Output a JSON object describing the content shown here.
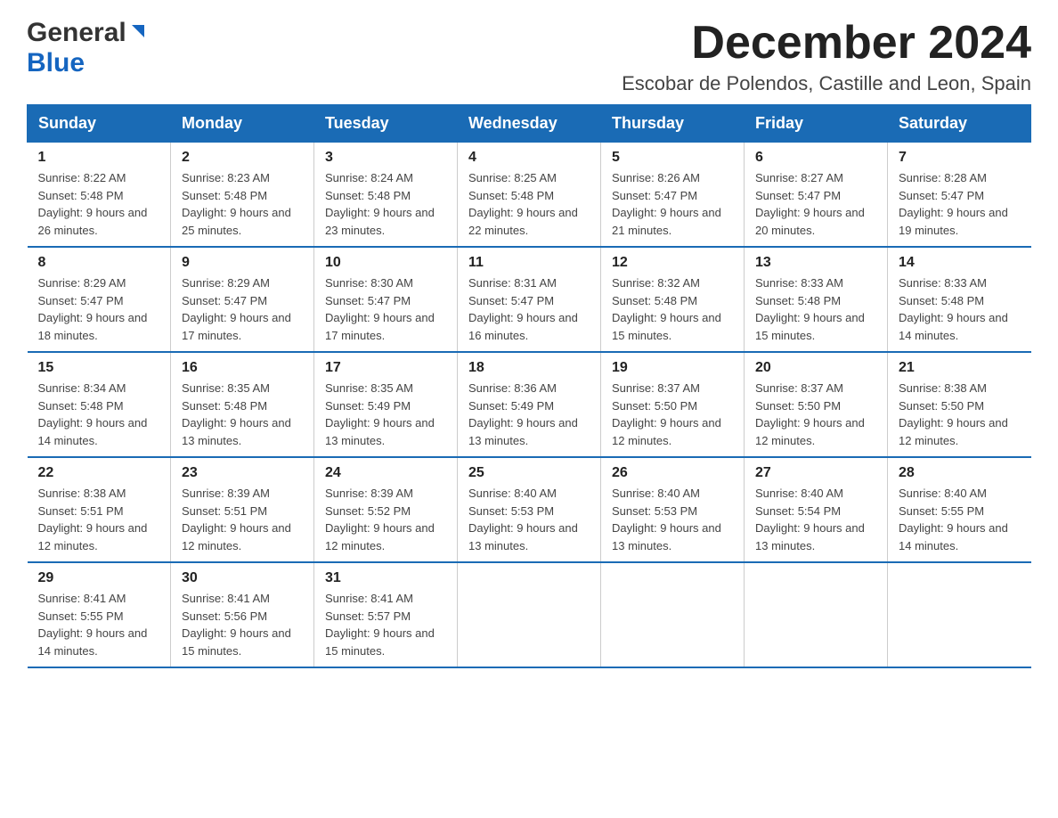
{
  "header": {
    "logo_general": "General",
    "logo_blue": "Blue",
    "month_title": "December 2024",
    "location": "Escobar de Polendos, Castille and Leon, Spain"
  },
  "days_of_week": [
    "Sunday",
    "Monday",
    "Tuesday",
    "Wednesday",
    "Thursday",
    "Friday",
    "Saturday"
  ],
  "weeks": [
    [
      {
        "day": "1",
        "sunrise": "8:22 AM",
        "sunset": "5:48 PM",
        "daylight": "9 hours and 26 minutes."
      },
      {
        "day": "2",
        "sunrise": "8:23 AM",
        "sunset": "5:48 PM",
        "daylight": "9 hours and 25 minutes."
      },
      {
        "day": "3",
        "sunrise": "8:24 AM",
        "sunset": "5:48 PM",
        "daylight": "9 hours and 23 minutes."
      },
      {
        "day": "4",
        "sunrise": "8:25 AM",
        "sunset": "5:48 PM",
        "daylight": "9 hours and 22 minutes."
      },
      {
        "day": "5",
        "sunrise": "8:26 AM",
        "sunset": "5:47 PM",
        "daylight": "9 hours and 21 minutes."
      },
      {
        "day": "6",
        "sunrise": "8:27 AM",
        "sunset": "5:47 PM",
        "daylight": "9 hours and 20 minutes."
      },
      {
        "day": "7",
        "sunrise": "8:28 AM",
        "sunset": "5:47 PM",
        "daylight": "9 hours and 19 minutes."
      }
    ],
    [
      {
        "day": "8",
        "sunrise": "8:29 AM",
        "sunset": "5:47 PM",
        "daylight": "9 hours and 18 minutes."
      },
      {
        "day": "9",
        "sunrise": "8:29 AM",
        "sunset": "5:47 PM",
        "daylight": "9 hours and 17 minutes."
      },
      {
        "day": "10",
        "sunrise": "8:30 AM",
        "sunset": "5:47 PM",
        "daylight": "9 hours and 17 minutes."
      },
      {
        "day": "11",
        "sunrise": "8:31 AM",
        "sunset": "5:47 PM",
        "daylight": "9 hours and 16 minutes."
      },
      {
        "day": "12",
        "sunrise": "8:32 AM",
        "sunset": "5:48 PM",
        "daylight": "9 hours and 15 minutes."
      },
      {
        "day": "13",
        "sunrise": "8:33 AM",
        "sunset": "5:48 PM",
        "daylight": "9 hours and 15 minutes."
      },
      {
        "day": "14",
        "sunrise": "8:33 AM",
        "sunset": "5:48 PM",
        "daylight": "9 hours and 14 minutes."
      }
    ],
    [
      {
        "day": "15",
        "sunrise": "8:34 AM",
        "sunset": "5:48 PM",
        "daylight": "9 hours and 14 minutes."
      },
      {
        "day": "16",
        "sunrise": "8:35 AM",
        "sunset": "5:48 PM",
        "daylight": "9 hours and 13 minutes."
      },
      {
        "day": "17",
        "sunrise": "8:35 AM",
        "sunset": "5:49 PM",
        "daylight": "9 hours and 13 minutes."
      },
      {
        "day": "18",
        "sunrise": "8:36 AM",
        "sunset": "5:49 PM",
        "daylight": "9 hours and 13 minutes."
      },
      {
        "day": "19",
        "sunrise": "8:37 AM",
        "sunset": "5:50 PM",
        "daylight": "9 hours and 12 minutes."
      },
      {
        "day": "20",
        "sunrise": "8:37 AM",
        "sunset": "5:50 PM",
        "daylight": "9 hours and 12 minutes."
      },
      {
        "day": "21",
        "sunrise": "8:38 AM",
        "sunset": "5:50 PM",
        "daylight": "9 hours and 12 minutes."
      }
    ],
    [
      {
        "day": "22",
        "sunrise": "8:38 AM",
        "sunset": "5:51 PM",
        "daylight": "9 hours and 12 minutes."
      },
      {
        "day": "23",
        "sunrise": "8:39 AM",
        "sunset": "5:51 PM",
        "daylight": "9 hours and 12 minutes."
      },
      {
        "day": "24",
        "sunrise": "8:39 AM",
        "sunset": "5:52 PM",
        "daylight": "9 hours and 12 minutes."
      },
      {
        "day": "25",
        "sunrise": "8:40 AM",
        "sunset": "5:53 PM",
        "daylight": "9 hours and 13 minutes."
      },
      {
        "day": "26",
        "sunrise": "8:40 AM",
        "sunset": "5:53 PM",
        "daylight": "9 hours and 13 minutes."
      },
      {
        "day": "27",
        "sunrise": "8:40 AM",
        "sunset": "5:54 PM",
        "daylight": "9 hours and 13 minutes."
      },
      {
        "day": "28",
        "sunrise": "8:40 AM",
        "sunset": "5:55 PM",
        "daylight": "9 hours and 14 minutes."
      }
    ],
    [
      {
        "day": "29",
        "sunrise": "8:41 AM",
        "sunset": "5:55 PM",
        "daylight": "9 hours and 14 minutes."
      },
      {
        "day": "30",
        "sunrise": "8:41 AM",
        "sunset": "5:56 PM",
        "daylight": "9 hours and 15 minutes."
      },
      {
        "day": "31",
        "sunrise": "8:41 AM",
        "sunset": "5:57 PM",
        "daylight": "9 hours and 15 minutes."
      },
      null,
      null,
      null,
      null
    ]
  ]
}
